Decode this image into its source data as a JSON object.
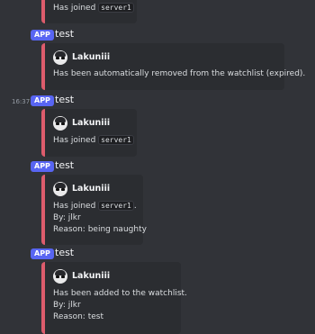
{
  "messages": [
    {
      "timestamp": "",
      "badge": "APP",
      "author": "test",
      "embed": {
        "username": "",
        "lines": [
          {
            "text": "Has joined ",
            "code": "server1",
            "after": ""
          }
        ]
      }
    },
    {
      "timestamp": "",
      "badge": "APP",
      "author": "test",
      "embed": {
        "username": "Lakuniii",
        "lines": [
          {
            "text": "Has been automatically removed from the watchlist (expired)."
          }
        ]
      }
    },
    {
      "timestamp": "16:37",
      "badge": "APP",
      "author": "test",
      "embed": {
        "username": "Lakuniii",
        "lines": [
          {
            "text": "Has joined ",
            "code": "server1",
            "after": ""
          }
        ]
      }
    },
    {
      "timestamp": "",
      "badge": "APP",
      "author": "test",
      "embed": {
        "username": "Lakuniii",
        "lines": [
          {
            "text": "Has joined ",
            "code": "server1",
            "after": "."
          },
          {
            "text": "By: jlkr"
          },
          {
            "text": "Reason: being naughty"
          }
        ]
      }
    },
    {
      "timestamp": "",
      "badge": "APP",
      "author": "test",
      "embed": {
        "username": "Lakuniii",
        "lines": [
          {
            "text": "Has been added to the watchlist."
          },
          {
            "text": "By: jlkr"
          },
          {
            "text": "Reason: test"
          }
        ]
      }
    }
  ],
  "accent_color": "#dd5c6c",
  "badge_color": "#5865f2"
}
